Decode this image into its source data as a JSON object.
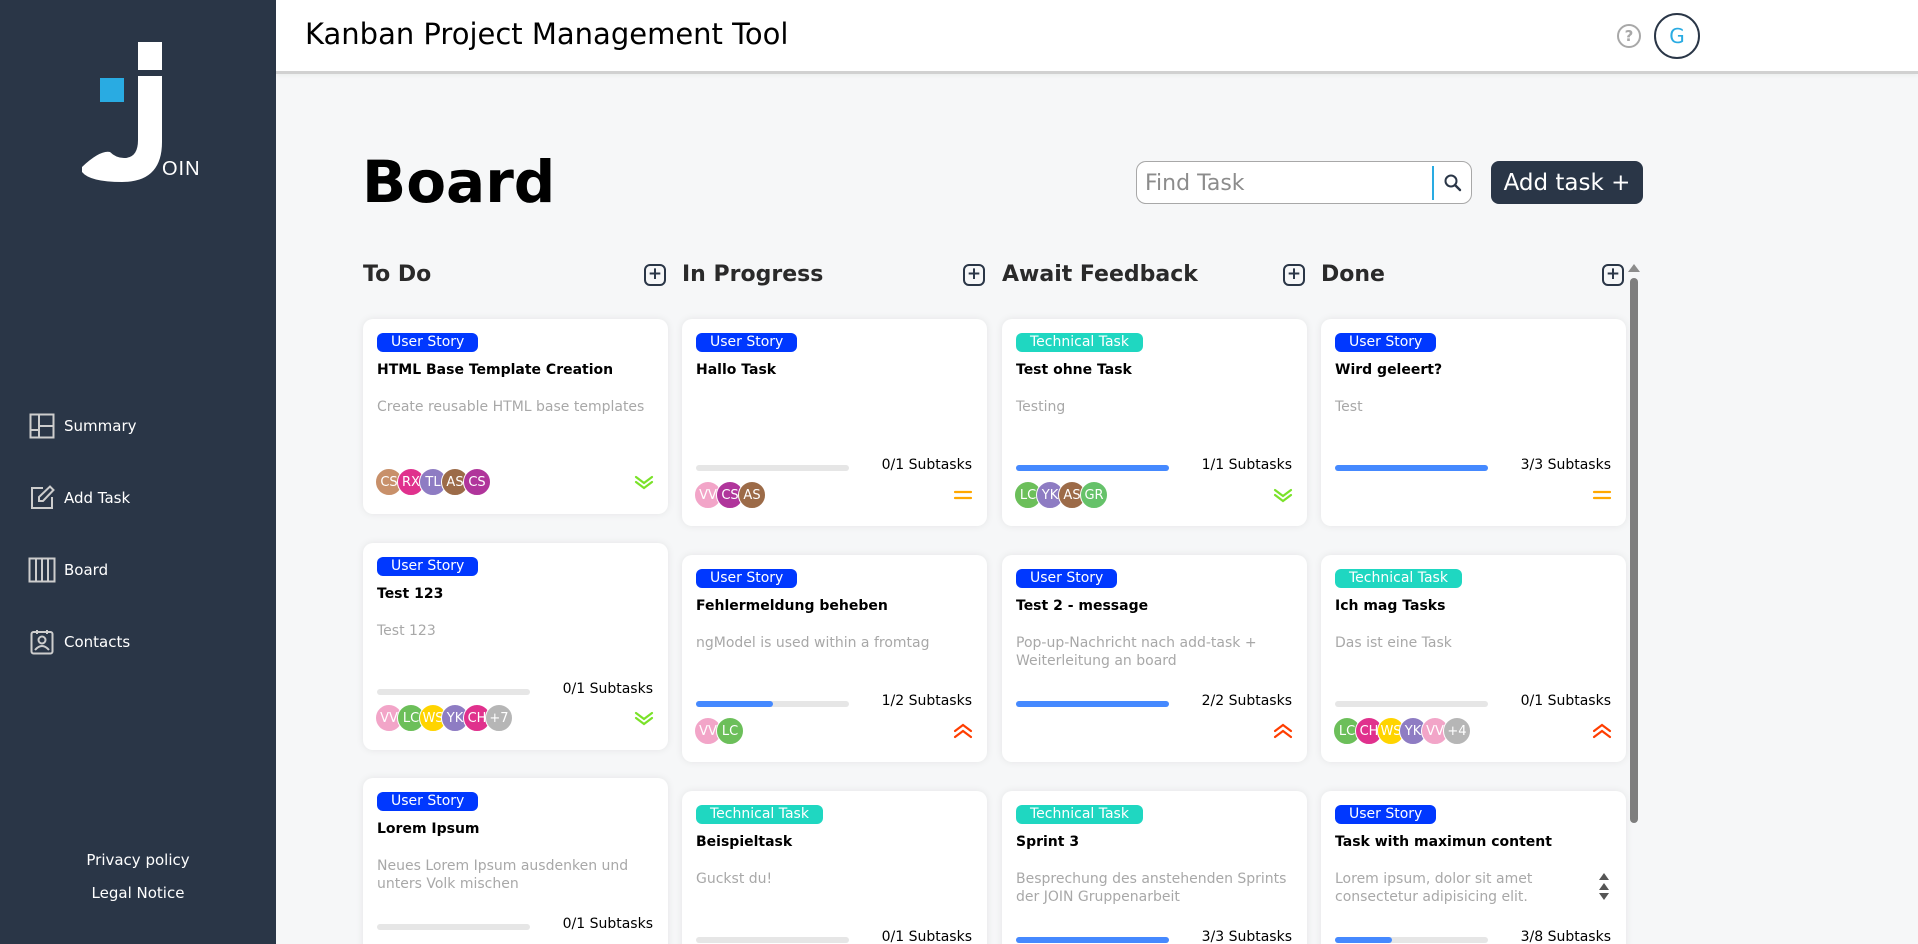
{
  "app": {
    "title": "Kanban Project Management Tool",
    "help_label": "?",
    "user_initial": "G",
    "logo_letters": "OIN"
  },
  "sidebar": {
    "items": [
      {
        "label": "Summary",
        "icon": "summary-icon"
      },
      {
        "label": "Add Task",
        "icon": "edit-icon"
      },
      {
        "label": "Board",
        "icon": "board-icon"
      },
      {
        "label": "Contacts",
        "icon": "contacts-icon"
      }
    ],
    "privacy": "Privacy policy",
    "legal": "Legal Notice"
  },
  "board": {
    "title": "Board",
    "search_placeholder": "Find Task",
    "add_task_label": "Add task +"
  },
  "colors": {
    "user_story": "#0038ff",
    "technical_task": "#1fd7c1",
    "prio_low": "#7ae229",
    "prio_medium": "#ffa800",
    "prio_urgent": "#ff3d00",
    "sidebar_bg": "#2a3647"
  },
  "columns": [
    {
      "title": "To Do",
      "cards": [
        {
          "category": "User Story",
          "title": "HTML Base Template Creation",
          "desc": "Create reusable HTML base templates",
          "subtasks": "",
          "progress": null,
          "avatars": [
            {
              "i": "CS",
              "c": "#c8906a"
            },
            {
              "i": "RX",
              "c": "#e0318d"
            },
            {
              "i": "TL",
              "c": "#8e7cc3"
            },
            {
              "i": "AS",
              "c": "#9c6b48"
            },
            {
              "i": "CS",
              "c": "#b0359b"
            }
          ],
          "prio": "low"
        },
        {
          "category": "User Story",
          "title": "Test 123",
          "desc": "Test 123",
          "subtasks": "0/1 Subtasks",
          "progress": 0,
          "avatars": [
            {
              "i": "VV",
              "c": "#f2a5c8"
            },
            {
              "i": "LC",
              "c": "#6cbf5a"
            },
            {
              "i": "WS",
              "c": "#ffd400"
            },
            {
              "i": "YK",
              "c": "#8e7cc3"
            },
            {
              "i": "CH",
              "c": "#e0318d"
            },
            {
              "i": "+7",
              "c": "#b6b6b6"
            }
          ],
          "prio": "low"
        },
        {
          "category": "User Story",
          "title": "Lorem Ipsum",
          "desc": "Neues Lorem Ipsum ausdenken und unters Volk mischen",
          "subtasks": "0/1 Subtasks",
          "progress": 0,
          "avatars": [],
          "prio": ""
        }
      ]
    },
    {
      "title": "In Progress",
      "cards": [
        {
          "category": "User Story",
          "title": "Hallo Task",
          "desc": "",
          "subtasks": "0/1 Subtasks",
          "progress": 0,
          "avatars": [
            {
              "i": "VV",
              "c": "#f2a5c8"
            },
            {
              "i": "CS",
              "c": "#b0359b"
            },
            {
              "i": "AS",
              "c": "#9c6b48"
            }
          ],
          "prio": "medium"
        },
        {
          "category": "User Story",
          "title": "Fehlermeldung beheben",
          "desc": "ngModel is used within a fromtag",
          "subtasks": "1/2 Subtasks",
          "progress": 0.5,
          "avatars": [
            {
              "i": "VV",
              "c": "#f2a5c8"
            },
            {
              "i": "LC",
              "c": "#6cbf5a"
            }
          ],
          "prio": "urgent"
        },
        {
          "category": "Technical Task",
          "title": "Beispieltask",
          "desc": "Guckst du!",
          "subtasks": "0/1 Subtasks",
          "progress": 0,
          "avatars": [],
          "prio": ""
        }
      ]
    },
    {
      "title": "Await Feedback",
      "cards": [
        {
          "category": "Technical Task",
          "title": "Test ohne Task",
          "desc": "Testing",
          "subtasks": "1/1 Subtasks",
          "progress": 1,
          "avatars": [
            {
              "i": "LC",
              "c": "#6cbf5a"
            },
            {
              "i": "YK",
              "c": "#8e7cc3"
            },
            {
              "i": "AS",
              "c": "#9c6b48"
            },
            {
              "i": "GR",
              "c": "#66c26a"
            }
          ],
          "prio": "low"
        },
        {
          "category": "User Story",
          "title": "Test 2 - message",
          "desc": "Pop-up-Nachricht nach add-task + Weiterleitung an board",
          "subtasks": "2/2 Subtasks",
          "progress": 1,
          "avatars": [],
          "prio": "urgent"
        },
        {
          "category": "Technical Task",
          "title": "Sprint 3",
          "desc": "Besprechung des anstehenden Sprints der JOIN Gruppenarbeit",
          "subtasks": "3/3 Subtasks",
          "progress": 1,
          "avatars": [],
          "prio": ""
        }
      ]
    },
    {
      "title": "Done",
      "cards": [
        {
          "category": "User Story",
          "title": "Wird geleert?",
          "desc": "Test",
          "subtasks": "3/3 Subtasks",
          "progress": 1,
          "avatars": [],
          "prio": "medium"
        },
        {
          "category": "Technical Task",
          "title": "Ich mag Tasks",
          "desc": "Das ist eine Task",
          "subtasks": "0/1 Subtasks",
          "progress": 0,
          "avatars": [
            {
              "i": "LC",
              "c": "#6cbf5a"
            },
            {
              "i": "CH",
              "c": "#e0318d"
            },
            {
              "i": "WS",
              "c": "#ffd400"
            },
            {
              "i": "YK",
              "c": "#8e7cc3"
            },
            {
              "i": "VV",
              "c": "#f2a5c8"
            },
            {
              "i": "+4",
              "c": "#b6b6b6"
            }
          ],
          "prio": "urgent"
        },
        {
          "category": "User Story",
          "title": "Task with maximun content",
          "desc": "Lorem ipsum, dolor sit amet consectetur adipisicing elit. Consequuntur quibusdam reiciendis",
          "subtasks": "3/8 Subtasks",
          "progress": 0.375,
          "avatars": [],
          "prio": ""
        }
      ]
    }
  ]
}
